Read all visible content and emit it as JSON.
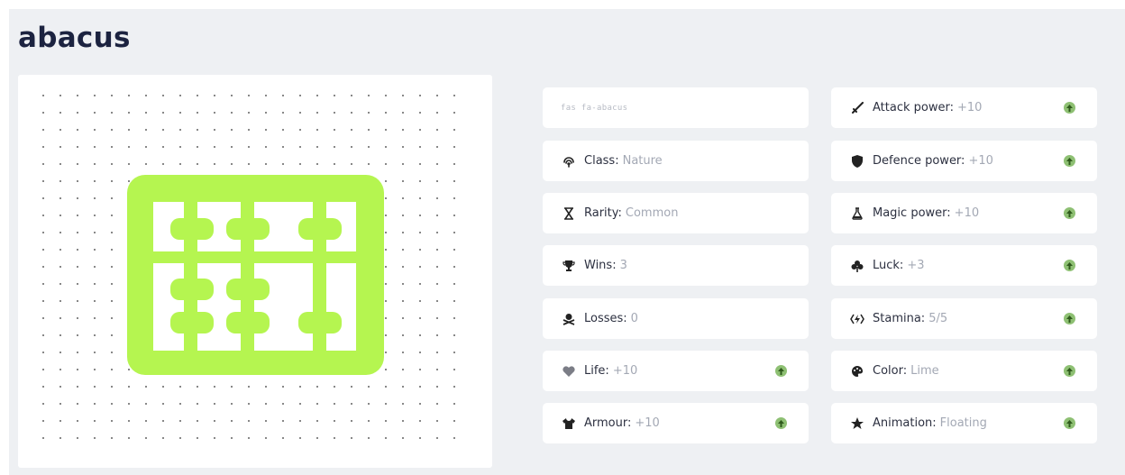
{
  "title": "abacus",
  "icon_class": "fas fa-abacus",
  "colors": {
    "accent": "#b5f550",
    "upgrade": "#8ec073",
    "background": "#eef0f3",
    "title": "#1c2340"
  },
  "left_stats": [
    {
      "icon": "fingerprint-icon",
      "label": "Class:",
      "value": "Nature",
      "upgradable": false
    },
    {
      "icon": "hourglass-icon",
      "label": "Rarity:",
      "value": "Common",
      "upgradable": false
    },
    {
      "icon": "trophy-icon",
      "label": "Wins:",
      "value": "3",
      "upgradable": false
    },
    {
      "icon": "skull-crossbones-icon",
      "label": "Losses:",
      "value": "0",
      "upgradable": false
    },
    {
      "icon": "heart-icon",
      "label": "Life:",
      "value": "+10",
      "upgradable": true
    },
    {
      "icon": "tshirt-icon",
      "label": "Armour:",
      "value": "+10",
      "upgradable": true
    }
  ],
  "right_stats": [
    {
      "icon": "sword-icon",
      "label": "Attack power:",
      "value": "+10",
      "upgradable": true
    },
    {
      "icon": "shield-icon",
      "label": "Defence power:",
      "value": "+10",
      "upgradable": true
    },
    {
      "icon": "flask-icon",
      "label": "Magic power:",
      "value": "+10",
      "upgradable": true
    },
    {
      "icon": "clover-icon",
      "label": "Luck:",
      "value": "+3",
      "upgradable": true
    },
    {
      "icon": "stamina-icon",
      "label": "Stamina:",
      "value": "5/5",
      "upgradable": true
    },
    {
      "icon": "palette-icon",
      "label": "Color:",
      "value": "Lime",
      "upgradable": true
    },
    {
      "icon": "star-icon",
      "label": "Animation:",
      "value": "Floating",
      "upgradable": true
    }
  ]
}
